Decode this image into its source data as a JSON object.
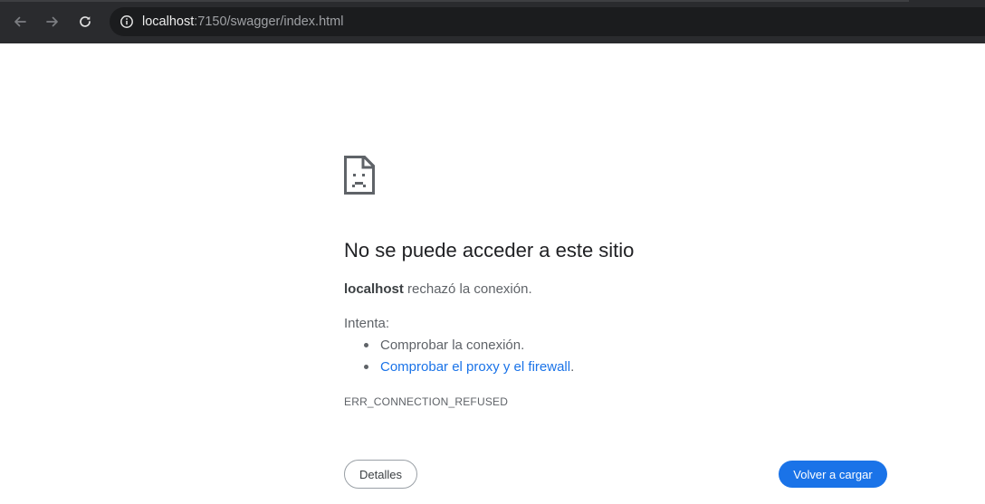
{
  "browser": {
    "back_icon": "arrow-left-icon",
    "forward_icon": "arrow-right-icon",
    "reload_icon": "reload-icon",
    "site_info_icon": "info-circle-icon",
    "url_host": "localhost",
    "url_rest": ":7150/swagger/index.html"
  },
  "error_page": {
    "icon": "sad-document-icon",
    "title": "No se puede acceder a este sitio",
    "host": "localhost",
    "description": " rechazó la conexión.",
    "try_label": "Intenta:",
    "suggestions": [
      {
        "text": "Comprobar la conexión.",
        "is_link": false
      },
      {
        "link_text": "Comprobar el proxy y el firewall",
        "suffix": ".",
        "is_link": true
      }
    ],
    "error_code": "ERR_CONNECTION_REFUSED",
    "details_button": "Detalles",
    "reload_button": "Volver a cargar"
  },
  "colors": {
    "toolbar_bg": "#2a2b2e",
    "omnibox_bg": "#1b1c1e",
    "link": "#1a73e8",
    "primary_button": "#1a73e8",
    "title_text": "#202124",
    "body_text": "#5f6368"
  }
}
